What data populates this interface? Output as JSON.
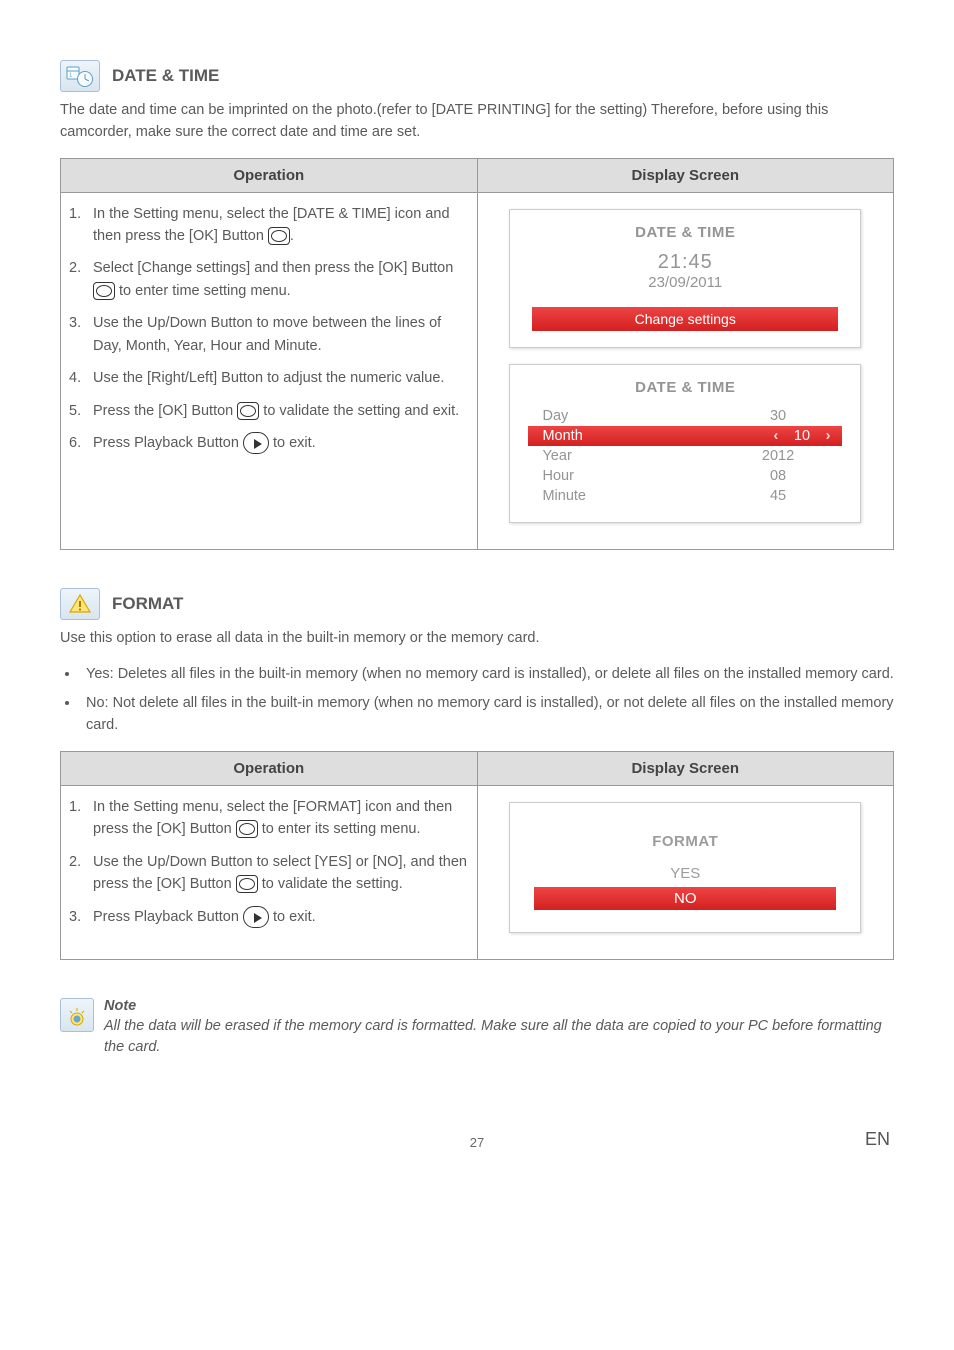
{
  "sections": {
    "dateTime": {
      "title": "DATE & TIME",
      "intro": "The date and time can be imprinted on the photo.(refer to [DATE PRINTING] for the setting) Therefore, before using this camcorder, make sure the correct date and time are set.",
      "headers": {
        "op": "Operation",
        "screen": "Display Screen"
      },
      "steps": {
        "s1a": "In the Setting menu, select the [DATE & TIME] icon and then press the [OK] Button ",
        "s1b": ".",
        "s2a": "Select [Change settings] and then press the [OK] Button ",
        "s2b": " to enter time setting menu.",
        "s3": "Use the Up/Down Button to move between the lines of Day, Month, Year, Hour and Minute.",
        "s4": "Use the [Right/Left] Button to adjust the numeric value.",
        "s5a": "Press the [OK] Button ",
        "s5b": " to validate the setting and exit.",
        "s6a": "Press Playback Button ",
        "s6b": " to exit."
      },
      "screen1": {
        "title": "DATE & TIME",
        "time": "21:45",
        "date": "23/09/2011",
        "button": "Change settings"
      },
      "screen2": {
        "title": "DATE & TIME",
        "rows": {
          "day": {
            "label": "Day",
            "val": "30"
          },
          "month": {
            "label": "Month",
            "val": "10"
          },
          "year": {
            "label": "Year",
            "val": "2012"
          },
          "hour": {
            "label": "Hour",
            "val": "08"
          },
          "minute": {
            "label": "Minute",
            "val": "45"
          }
        }
      }
    },
    "format": {
      "title": "FORMAT",
      "intro": "Use this option to erase all data in the built-in memory or the memory card.",
      "bullets": {
        "b1": "Yes: Deletes all files in the built-in memory (when no memory card is installed), or delete all files on the installed memory card.",
        "b2": "No: Not delete all files in the built-in memory (when no memory card is installed), or not delete all files on the installed memory card."
      },
      "headers": {
        "op": "Operation",
        "screen": "Display Screen"
      },
      "steps": {
        "s1a": "In the Setting menu, select the [FORMAT] icon and then press the [OK] Button ",
        "s1b": " to enter its setting menu.",
        "s2a": "Use the Up/Down Button to select [YES] or [NO], and then press the [OK] Button ",
        "s2b": " to validate the setting.",
        "s3a": "Press Playback Button ",
        "s3b": " to exit."
      },
      "screen": {
        "title": "FORMAT",
        "yes": "YES",
        "no": "NO"
      }
    }
  },
  "note": {
    "title": "Note",
    "text": "All the data will be erased if the memory card is formatted. Make sure all the data are copied to your PC before formatting the card."
  },
  "footer": {
    "page": "27",
    "lang": "EN"
  }
}
